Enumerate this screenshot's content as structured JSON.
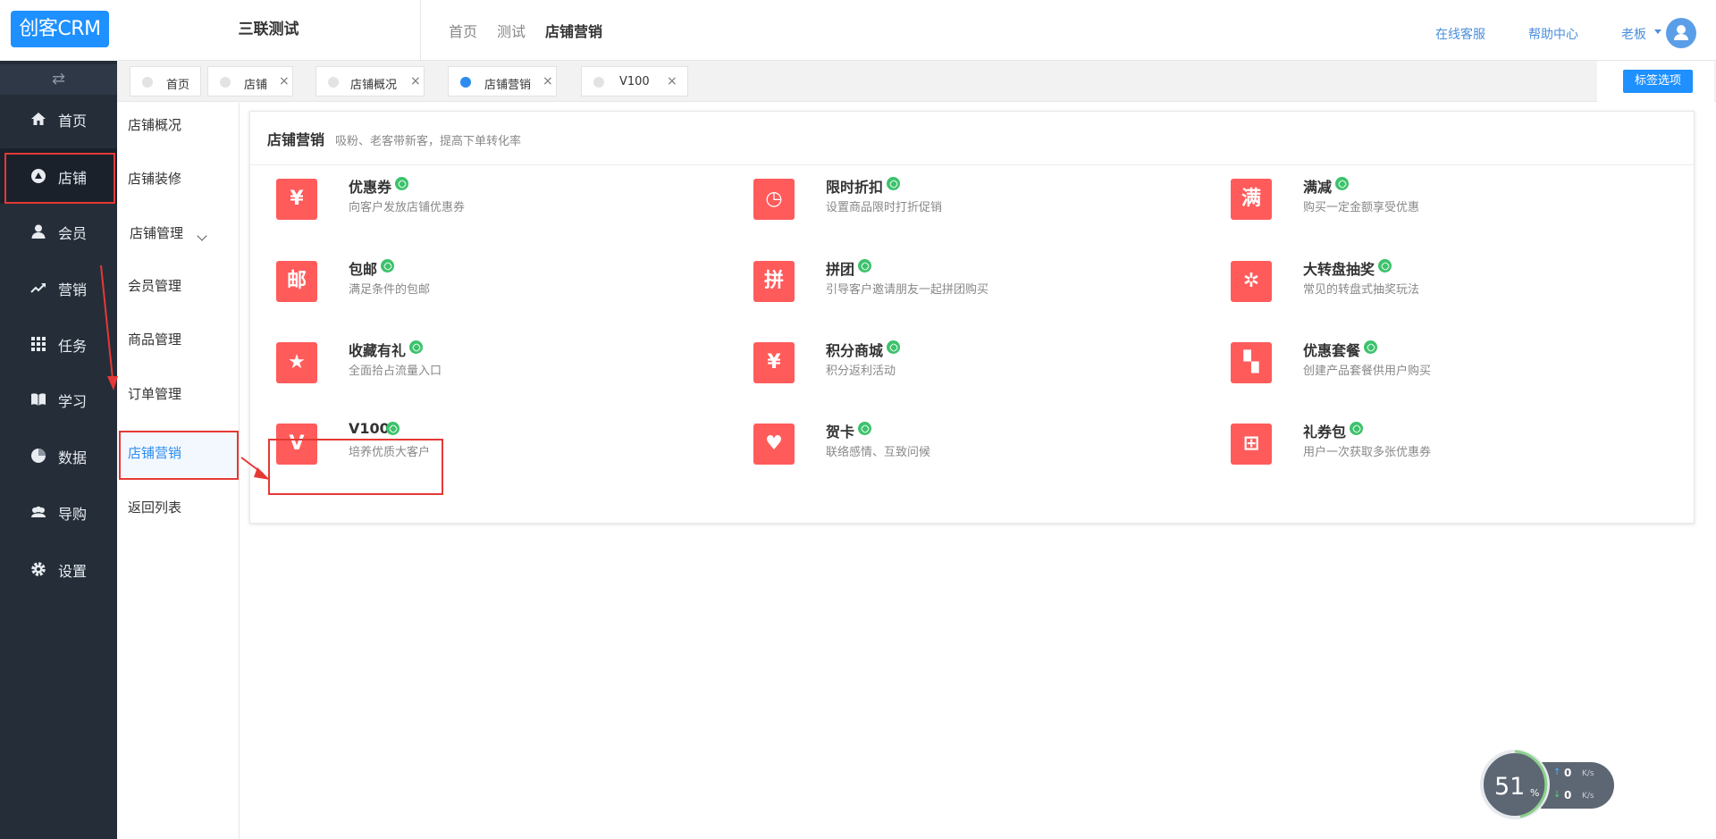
{
  "app": {
    "logo_text": "创客CRM",
    "org_title": "三联测试"
  },
  "header": {
    "breadcrumbs": [
      "首页",
      "测试",
      "店铺营销"
    ],
    "links": {
      "service": "在线客服",
      "help": "帮助中心"
    },
    "user": {
      "name": "老板"
    }
  },
  "sidebar": {
    "toggle_glyph": "⇄",
    "items": [
      {
        "label": "首页",
        "icon": "home-icon"
      },
      {
        "label": "店铺",
        "icon": "store-icon"
      },
      {
        "label": "会员",
        "icon": "user-icon"
      },
      {
        "label": "营销",
        "icon": "trend-icon"
      },
      {
        "label": "任务",
        "icon": "grid-icon"
      },
      {
        "label": "学习",
        "icon": "book-icon"
      },
      {
        "label": "数据",
        "icon": "pie-icon"
      },
      {
        "label": "导购",
        "icon": "team-icon"
      },
      {
        "label": "设置",
        "icon": "gear-icon"
      }
    ],
    "active_index": 1
  },
  "tabs": {
    "items": [
      {
        "label": "首页",
        "closable": false
      },
      {
        "label": "店铺",
        "closable": true
      },
      {
        "label": "店铺概况",
        "closable": true
      },
      {
        "label": "店铺营销",
        "closable": true
      },
      {
        "label": "V100",
        "closable": true
      }
    ],
    "active_index": 3,
    "close_glyph": "×",
    "options_label": "标签选项"
  },
  "submenu": {
    "items": [
      "店铺概况",
      "店铺装修",
      "店铺管理",
      "会员管理",
      "商品管理",
      "订单管理",
      "店铺营销",
      "返回列表"
    ],
    "active_index": 6
  },
  "panel": {
    "title": "店铺营销",
    "subtitle": "吸粉、老客带新客，提高下单转化率",
    "cards": [
      {
        "name": "优惠券",
        "desc": "向客户发放店铺优惠券",
        "icon": "coupon-icon",
        "glyph": "¥"
      },
      {
        "name": "限时折扣",
        "desc": "设置商品限时打折促销",
        "icon": "clock-icon",
        "glyph": "◷"
      },
      {
        "name": "满减",
        "desc": "购买一定金额享受优惠",
        "icon": "full-reduction-icon",
        "glyph": "满"
      },
      {
        "name": "包邮",
        "desc": "满足条件的包邮",
        "icon": "free-shipping-icon",
        "glyph": "邮"
      },
      {
        "name": "拼团",
        "desc": "引导客户邀请朋友一起拼团购买",
        "icon": "group-buy-icon",
        "glyph": "拼"
      },
      {
        "name": "大转盘抽奖",
        "desc": "常见的转盘式抽奖玩法",
        "icon": "wheel-icon",
        "glyph": "✲"
      },
      {
        "name": "收藏有礼",
        "desc": "全面拾占流量入口",
        "icon": "star-icon",
        "glyph": "★"
      },
      {
        "name": "积分商城",
        "desc": "积分返利活动",
        "icon": "points-bag-icon",
        "glyph": "¥"
      },
      {
        "name": "优惠套餐",
        "desc": "创建产品套餐供用户购买",
        "icon": "package-icon",
        "glyph": "▚"
      },
      {
        "name": "V100",
        "desc": "培养优质大客户",
        "icon": "v100-icon",
        "glyph": "V"
      },
      {
        "name": "贺卡",
        "desc": "联络感情、互致问候",
        "icon": "greeting-card-icon",
        "glyph": "♥"
      },
      {
        "name": "礼券包",
        "desc": "用户一次获取多张优惠券",
        "icon": "gift-icon",
        "glyph": "⊞"
      }
    ]
  },
  "speed_widget": {
    "percent": "51",
    "percent_unit": "%",
    "upload": "0",
    "download": "0",
    "unit": "K/s"
  },
  "colors": {
    "sidebar_bg": "#252d38",
    "accent": "#1e90ff",
    "card_icon_bg": "#ff5b5b",
    "link_green": "#3cc26c",
    "highlight_red": "#e53935"
  }
}
